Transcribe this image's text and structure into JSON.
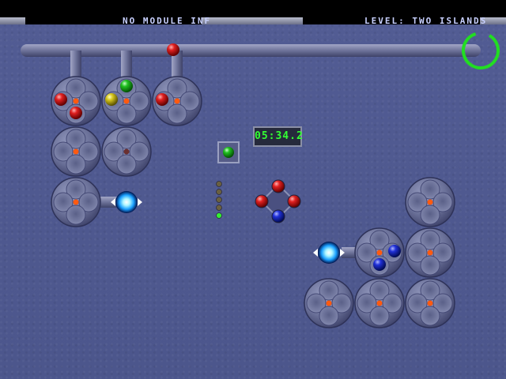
{
  "hud": {
    "module_info": "NO MODULE INF",
    "level_label": "LEVEL: TWO ISLANDS"
  },
  "timer": "05:34.2",
  "colors": {
    "red": "#c81414",
    "green": "#18b418",
    "yellow": "#d6c81c",
    "blue": "#1e2ec8",
    "timer_green": "#33ff33",
    "ring_green": "#22dd22"
  },
  "icons": [
    "timer-ring-icon",
    "teleporter-icon",
    "color-indicator-icon"
  ],
  "wheels": [
    {
      "id": "wheel-a1",
      "balls": [
        "red",
        "red"
      ]
    },
    {
      "id": "wheel-a2",
      "balls": [
        "green",
        "yellow"
      ]
    },
    {
      "id": "wheel-a3",
      "balls": [
        "red"
      ]
    },
    {
      "id": "wheel-b1",
      "balls": []
    },
    {
      "id": "wheel-b2",
      "balls": []
    },
    {
      "id": "wheel-c1",
      "balls": []
    },
    {
      "id": "wheel-r1",
      "balls": []
    },
    {
      "id": "wheel-r2",
      "balls": [
        "blue",
        "blue"
      ]
    },
    {
      "id": "wheel-r3",
      "balls": []
    },
    {
      "id": "wheel-r4",
      "balls": []
    },
    {
      "id": "wheel-r5",
      "balls": []
    },
    {
      "id": "wheel-r6",
      "balls": []
    }
  ],
  "pipe_ball": "red",
  "indicator_ball": "green",
  "sequence_lights": [
    "off",
    "off",
    "off",
    "off",
    "green"
  ],
  "center_balls": [
    "red",
    "red",
    "red",
    "blue"
  ]
}
